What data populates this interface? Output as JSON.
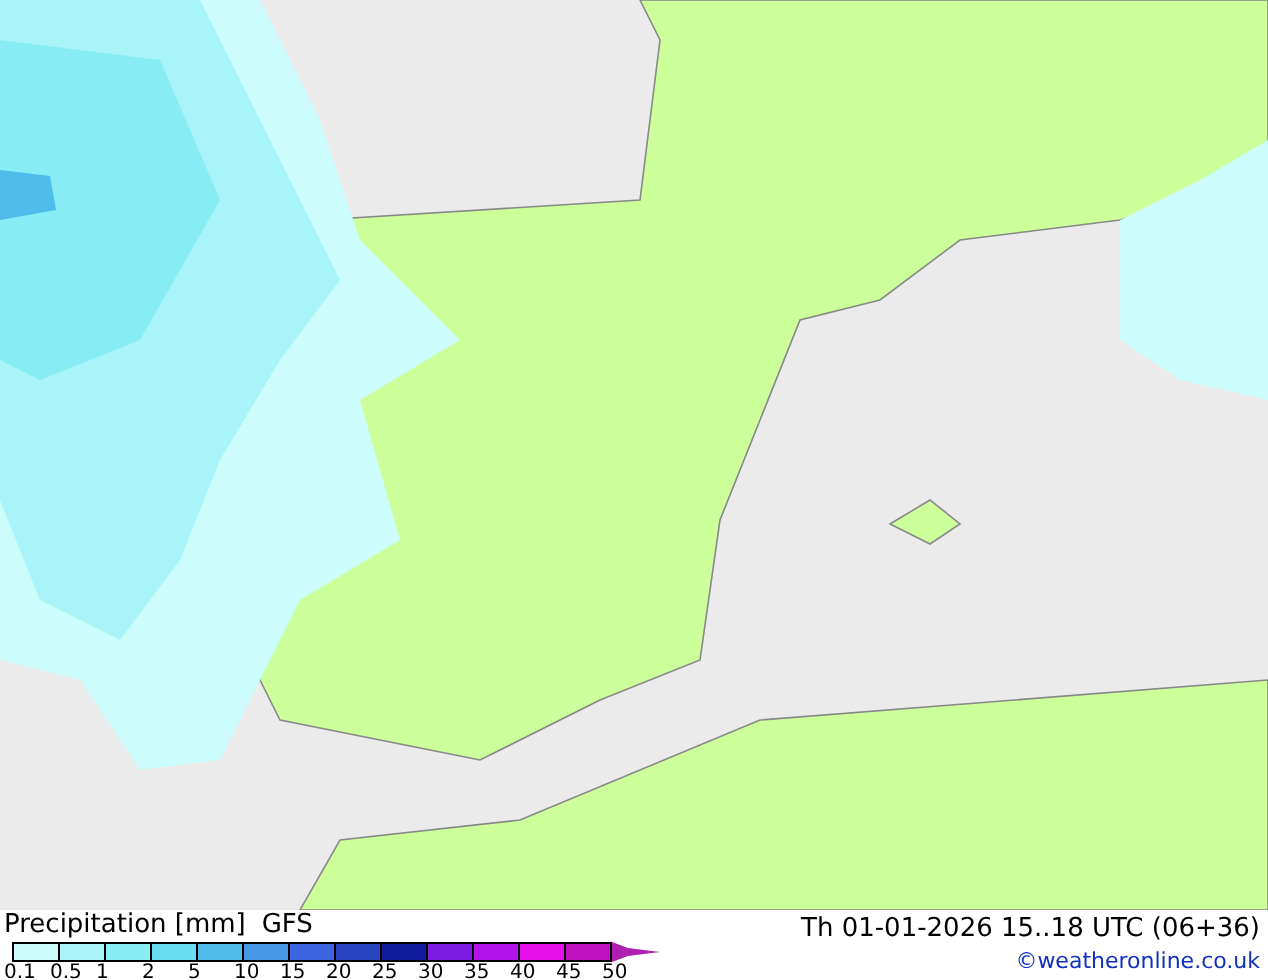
{
  "title": "Precipitation [mm]",
  "model": "GFS",
  "datetime": "Th 01-01-2026 15..18 UTC (06+36)",
  "credit": "©weatheronline.co.uk",
  "legend": [
    {
      "label": "0.1",
      "color": "#ccfcfc"
    },
    {
      "label": "0.5",
      "color": "#a8f4f8"
    },
    {
      "label": "1",
      "color": "#88ecf4"
    },
    {
      "label": "2",
      "color": "#68dcf0"
    },
    {
      "label": "5",
      "color": "#50bcec"
    },
    {
      "label": "10",
      "color": "#4898e8"
    },
    {
      "label": "15",
      "color": "#3c64e0"
    },
    {
      "label": "20",
      "color": "#2844c0"
    },
    {
      "label": "25",
      "color": "#101c9c"
    },
    {
      "label": "30",
      "color": "#7c1ce0"
    },
    {
      "label": "35",
      "color": "#b014e8"
    },
    {
      "label": "40",
      "color": "#e810ec"
    },
    {
      "label": "45",
      "color": "#c010c0"
    },
    {
      "label": "50",
      "color": "#b020b0"
    }
  ]
}
